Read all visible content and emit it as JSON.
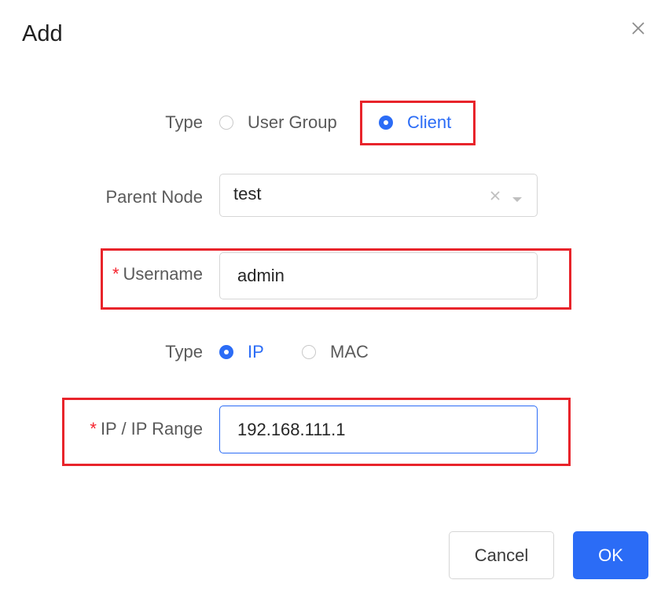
{
  "dialog": {
    "title": "Add",
    "close_icon": "close-icon"
  },
  "form": {
    "type_row": {
      "label": "Type",
      "options": [
        {
          "label": "User Group",
          "checked": false
        },
        {
          "label": "Client",
          "checked": true
        }
      ]
    },
    "parent_node": {
      "label": "Parent Node",
      "value": "test",
      "clear_icon": "clear-icon",
      "dropdown_icon": "chevron-down-icon"
    },
    "username": {
      "required_mark": "*",
      "label": "Username",
      "value": "admin"
    },
    "address_type": {
      "label": "Type",
      "options": [
        {
          "label": "IP",
          "checked": true
        },
        {
          "label": "MAC",
          "checked": false
        }
      ]
    },
    "ip_range": {
      "required_mark": "*",
      "label": "IP / IP Range",
      "value": "192.168.111.1"
    }
  },
  "footer": {
    "cancel_label": "Cancel",
    "ok_label": "OK"
  },
  "colors": {
    "accent": "#2b6cf6",
    "highlight": "#e8242b",
    "required": "#f5222d"
  }
}
